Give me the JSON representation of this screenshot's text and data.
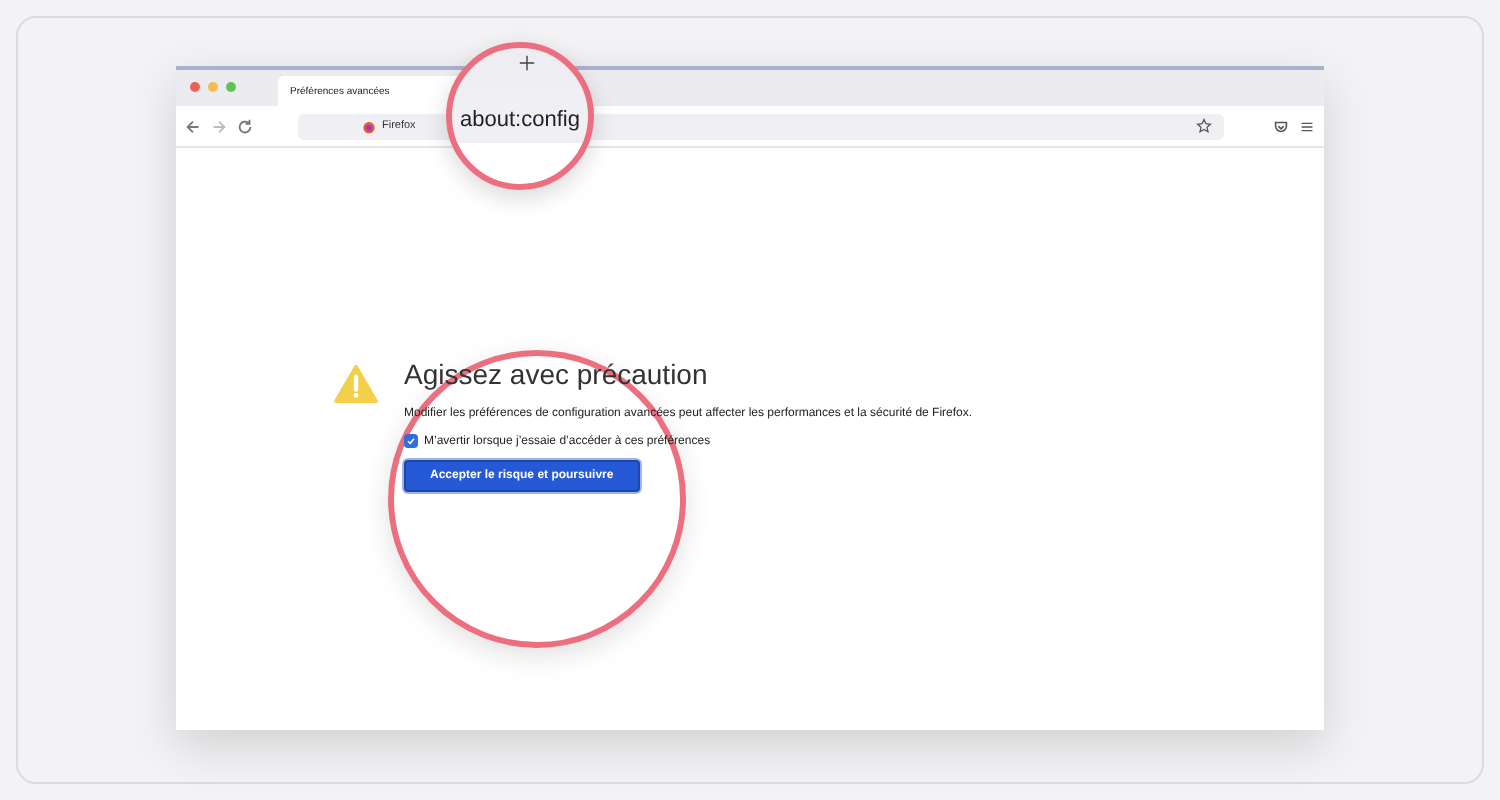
{
  "tab": {
    "title": "Préférences avancées"
  },
  "address_bar": {
    "identity": "Firefox"
  },
  "magnifier": {
    "url": "about:config"
  },
  "warning": {
    "title": "Agissez avec précaution",
    "description": "Modifier les préférences de configuration avancées peut affecter les performances et la sécurité de Firefox.",
    "checkbox": {
      "label": "M’avertir lorsque j’essaie d’accéder à ces préférences",
      "checked": true
    },
    "button": "Accepter le risque et poursuivre"
  }
}
